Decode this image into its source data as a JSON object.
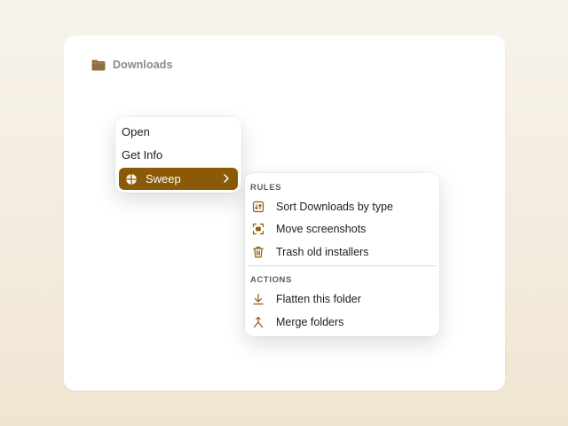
{
  "window": {
    "title": "Downloads",
    "title_icon": "folder-icon"
  },
  "context_menu": {
    "items": [
      {
        "label": "Open"
      },
      {
        "label": "Get Info"
      },
      {
        "label": "Sweep",
        "icon": "sweep-icon",
        "has_submenu": true,
        "highlighted": true
      }
    ]
  },
  "submenu": {
    "rules_header": "RULES",
    "rules": [
      {
        "label": "Sort Downloads by type",
        "icon": "sort-icon"
      },
      {
        "label": "Move screenshots",
        "icon": "screenshot-icon"
      },
      {
        "label": "Trash old installers",
        "icon": "trash-icon"
      }
    ],
    "actions_header": "ACTIONS",
    "actions": [
      {
        "label": "Flatten this folder",
        "icon": "flatten-icon"
      },
      {
        "label": "Merge folders",
        "icon": "merge-icon"
      }
    ]
  },
  "colors": {
    "accent": "#8a5a06",
    "icon": "#8a5a06",
    "background_top": "#f7f3ec",
    "background_bottom": "#f0e5d2"
  }
}
